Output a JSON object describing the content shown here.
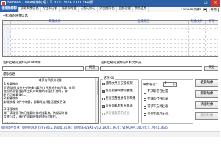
{
  "window": {
    "title": "WimTool - WIM映像处理工具 V1.0.2024.1111 x64版",
    "minimize": "—",
    "maximize": "☐",
    "close": "✕"
  },
  "menu": {
    "tabs": [
      "挂载和解卸",
      "获取映像信息",
      "导出和分解",
      "捕获和增量",
      "分卷的拆分",
      "外围图形化",
      "追加功能",
      "系统还原"
    ],
    "language": "Chinese(简体)",
    "help_button": "帮助"
  },
  "mounted_section": {
    "label": "已挂载的映像信息",
    "columns": [
      "",
      "映像文件",
      "挂载路径",
      "映像文件",
      "可写"
    ],
    "empty_rows": 8
  },
  "wim_file": {
    "label": "选择挂载或解卸的WIM文件",
    "value": "",
    "browse": "浏览"
  },
  "mount_dir": {
    "label": "选择挂载或解卸的目标文件夹",
    "value": "",
    "browse": "浏览"
  },
  "tips": {
    "label": "提示信息",
    "lines": [
      "本页有四部分功能",
      "1.挂载映像",
      "可将WIM 文件中的映像挂载到文件系统中的目录，从而",
      "使用资源管理器等工具对映像的内容进行修改，修",
      "改后可卸载保存。",
      "2.卸载映像",
      "卸载映像 文件中映像，卸载时选择是否提交更改",
      "",
      "3.清理映像",
      "用于清理损坏的已挂载映像的挂载点，为保证映像",
      "文件可用，建议在卸载映像前执行此操作。",
      "",
      "4.删除映像",
      "本工具中删除映像与 Dism++ 删除映像功能相同。"
    ]
  },
  "options": {
    "label": "选项(O)",
    "items": [
      {
        "label": "删除文件夹安全权限",
        "checked": true,
        "disabled": false
      },
      {
        "label": "总是检查映像完整性",
        "checked": true,
        "disabled": false
      },
      {
        "label": "检查完整性并保存映像",
        "checked": false,
        "disabled": false
      },
      {
        "label": "仅在卸载后打开目录",
        "checked": true,
        "disabled": false
      },
      {
        "label": "执行挂载前的检查",
        "checked": false,
        "disabled": true
      }
    ]
  },
  "image_index": {
    "label": "映像卷号：",
    "value": "1"
  },
  "options2": {
    "items": [
      {
        "label": "不获取卷名位置",
        "checked": false
      },
      {
        "label": "完成后打开目录",
        "checked": false
      },
      {
        "label": "可读写方式挂载",
        "checked": false
      },
      {
        "label": "任务完成后关机",
        "checked": false
      }
    ]
  },
  "actions": {
    "mount": "挂载映像",
    "unmount": "卸载映像",
    "cleanup": "清理映像",
    "delete": "删除映像"
  },
  "status": {
    "text": "WIM组件信息：WIMMOUNT.SYS-V6.2.19041.3636；WIMSERV.EXE-V6.2.19041.3636；WIMGAPI.DLL-V6.2.19041.3636"
  }
}
